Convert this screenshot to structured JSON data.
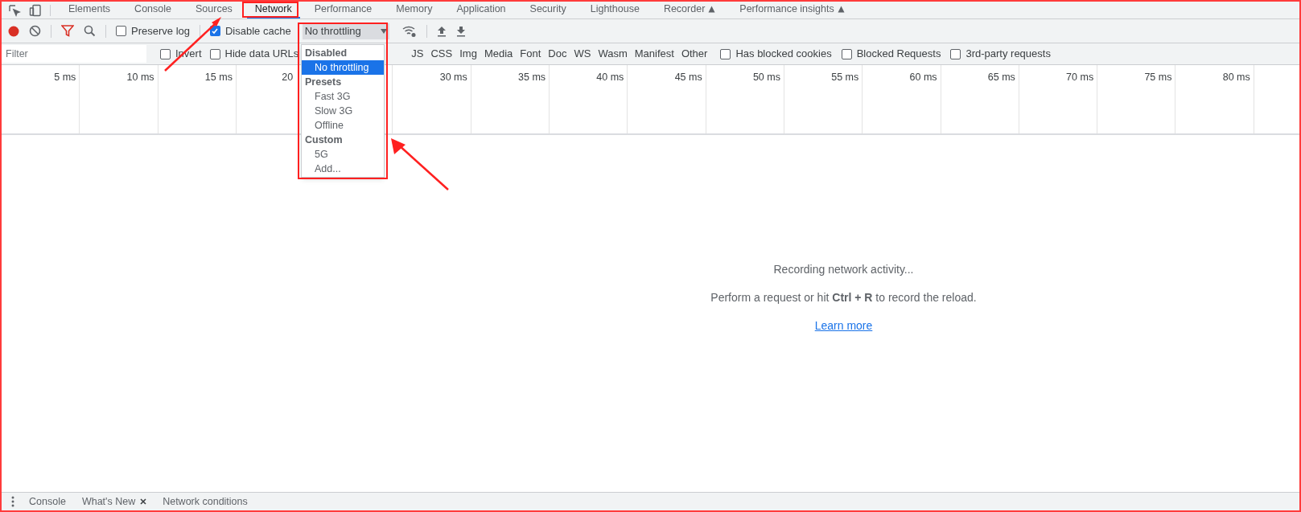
{
  "tabs": [
    {
      "label": "Elements",
      "selected": false,
      "kind": "plain"
    },
    {
      "label": "Console",
      "selected": false,
      "kind": "plain"
    },
    {
      "label": "Sources",
      "selected": false,
      "kind": "plain"
    },
    {
      "label": "Network",
      "selected": true,
      "kind": "plain"
    },
    {
      "label": "Performance",
      "selected": false,
      "kind": "plain"
    },
    {
      "label": "Memory",
      "selected": false,
      "kind": "plain"
    },
    {
      "label": "Application",
      "selected": false,
      "kind": "plain"
    },
    {
      "label": "Security",
      "selected": false,
      "kind": "plain"
    },
    {
      "label": "Lighthouse",
      "selected": false,
      "kind": "plain"
    },
    {
      "label": "Recorder",
      "selected": false,
      "kind": "experimental"
    },
    {
      "label": "Performance insights",
      "selected": false,
      "kind": "experimental"
    }
  ],
  "toolbar": {
    "recording": true,
    "preserve_log": {
      "label": "Preserve log",
      "checked": false
    },
    "disable_cache": {
      "label": "Disable cache",
      "checked": true
    },
    "throttling": {
      "value": "No throttling",
      "expanded": true
    }
  },
  "throttling_menu": [
    {
      "label": "Disabled",
      "items": [
        {
          "label": "No throttling",
          "selected": true
        }
      ]
    },
    {
      "label": "Presets",
      "items": [
        {
          "label": "Fast 3G",
          "selected": false
        },
        {
          "label": "Slow 3G",
          "selected": false
        },
        {
          "label": "Offline",
          "selected": false
        }
      ]
    },
    {
      "label": "Custom",
      "items": [
        {
          "label": "5G",
          "selected": false
        },
        {
          "label": "Add...",
          "selected": false
        }
      ]
    }
  ],
  "filter": {
    "placeholder": "Filter",
    "invert": {
      "label": "Invert",
      "checked": false
    },
    "hide_data_urls": {
      "label": "Hide data URLs",
      "checked": false
    },
    "types": [
      "JS",
      "CSS",
      "Img",
      "Media",
      "Font",
      "Doc",
      "WS",
      "Wasm",
      "Manifest",
      "Other"
    ],
    "options": [
      {
        "label": "Has blocked cookies",
        "checked": false
      },
      {
        "label": "Blocked Requests",
        "checked": false
      },
      {
        "label": "3rd-party requests",
        "checked": false
      }
    ]
  },
  "timeline": {
    "ticks": [
      {
        "label": "5 ms"
      },
      {
        "label": "10 ms"
      },
      {
        "label": "15 ms"
      },
      {
        "label": "20",
        "cut": true
      },
      {
        "label": "30 ms"
      },
      {
        "label": "35 ms"
      },
      {
        "label": "40 ms"
      },
      {
        "label": "45 ms"
      },
      {
        "label": "50 ms"
      },
      {
        "label": "55 ms"
      },
      {
        "label": "60 ms"
      },
      {
        "label": "65 ms"
      },
      {
        "label": "70 ms"
      },
      {
        "label": "75 ms"
      },
      {
        "label": "80 ms"
      }
    ]
  },
  "empty_state": {
    "title": "Recording network activity...",
    "hint": "Perform a request or hit **Ctrl + R** to record the reload.",
    "link": "Learn more"
  },
  "drawer_tabs": [
    {
      "label": "Console",
      "closable": false
    },
    {
      "label": "What's New",
      "closable": true
    },
    {
      "label": "Network conditions",
      "closable": false
    }
  ]
}
